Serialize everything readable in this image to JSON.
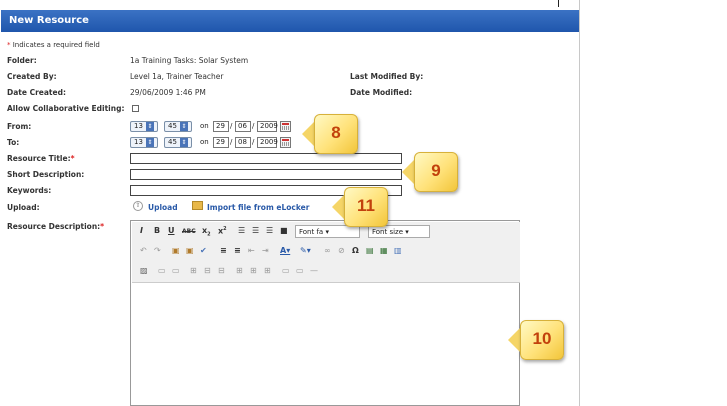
{
  "window": {
    "title": "New Resource"
  },
  "form": {
    "required_note_star": "*",
    "required_note": "Indicates a required field",
    "folder": {
      "label": "Folder:",
      "value": "1a Training Tasks: Solar System"
    },
    "created_by": {
      "label": "Created By:",
      "value": "Level 1a, Trainer Teacher"
    },
    "date_created": {
      "label": "Date Created:",
      "value": "29/06/2009 1:46 PM"
    },
    "last_modified_by": {
      "label": "Last Modified By:"
    },
    "date_modified": {
      "label": "Date Modified:"
    },
    "collab": {
      "label": "Allow Collaborative Editing:",
      "checked": false
    },
    "from": {
      "label": "From:",
      "hour": "13",
      "minute": "45",
      "on": "on",
      "day": "29",
      "month": "06",
      "year": "2009"
    },
    "to": {
      "label": "To:",
      "hour": "13",
      "minute": "45",
      "on": "on",
      "day": "29",
      "month": "08",
      "year": "2009"
    },
    "resource_title": {
      "label": "Resource Title:",
      "star": "*",
      "value": ""
    },
    "short_description": {
      "label": "Short Description:",
      "value": ""
    },
    "keywords": {
      "label": "Keywords:",
      "value": ""
    },
    "upload": {
      "label": "Upload:",
      "upload_link": "Upload",
      "import_link": "Import file from eLocker"
    },
    "resource_description": {
      "label": "Resource Description:",
      "star": "*"
    }
  },
  "editor": {
    "font_family": "Font fa",
    "font_size": "Font size"
  },
  "callouts": [
    "8",
    "9",
    "10",
    "11"
  ]
}
